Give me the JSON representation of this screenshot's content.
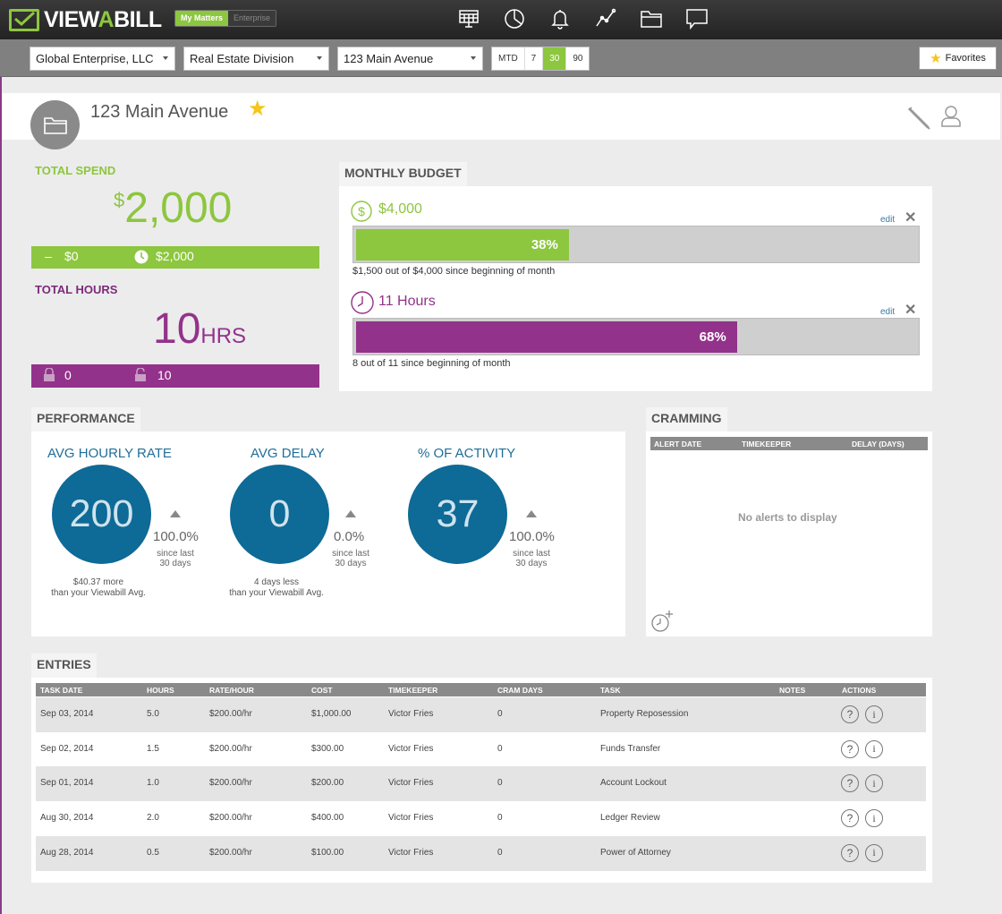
{
  "app": {
    "brand_part1": "VIEW",
    "brand_a": "A",
    "brand_part2": "BILL",
    "toggle_on": "My Matters",
    "toggle_off": "Enterprise"
  },
  "nav_icons": [
    "dashboard-icon",
    "pie-chart-icon",
    "bell-icon",
    "line-chart-icon",
    "folder-icon",
    "chat-icon"
  ],
  "filters": {
    "company": "Global Enterprise, LLC",
    "division": "Real Estate Division",
    "matter": "123 Main Avenue",
    "ranges": [
      "MTD",
      "7",
      "30",
      "90"
    ],
    "selected_range": "30",
    "favorites": "Favorites"
  },
  "matter": {
    "title": "123 Main Avenue"
  },
  "spend": {
    "label": "TOTAL SPEND",
    "currency": "$",
    "amount": "2,000",
    "left_value": "$0",
    "right_value": "$2,000"
  },
  "hours": {
    "label": "TOTAL HOURS",
    "amount": "10",
    "unit": "HRS",
    "locked": "0",
    "unlocked": "10"
  },
  "budget": {
    "tab": "MONTHLY BUDGET",
    "edit": "edit",
    "money": {
      "amount": "$4,000",
      "percent": 38,
      "percent_label": "38%",
      "note": "$1,500 out of $4,000 since beginning of month"
    },
    "time": {
      "amount": "11 Hours",
      "percent": 68,
      "percent_label": "68%",
      "note": "8 out of 11 since beginning of month"
    }
  },
  "performance": {
    "tab": "PERFORMANCE",
    "metrics": [
      {
        "title": "AVG HOURLY RATE",
        "value": "200",
        "change": "100.0%",
        "since1": "since last",
        "since2": "30 days",
        "below1": "$40.37 more",
        "below2": "than your Viewabill Avg."
      },
      {
        "title": "AVG DELAY",
        "value": "0",
        "change": "0.0%",
        "since1": "since last",
        "since2": "30 days",
        "below1": "4 days less",
        "below2": "than your Viewabill Avg."
      },
      {
        "title": "% OF ACTIVITY",
        "value": "37",
        "change": "100.0%",
        "since1": "since last",
        "since2": "30 days",
        "below1": "",
        "below2": ""
      }
    ]
  },
  "cramming": {
    "tab": "CRAMMING",
    "cols": [
      "ALERT DATE",
      "TIMEKEEPER",
      "DELAY (DAYS)"
    ],
    "empty": "No alerts to display"
  },
  "entries": {
    "tab": "ENTRIES",
    "cols": [
      "TASK DATE",
      "HOURS",
      "RATE/HOUR",
      "COST",
      "TIMEKEEPER",
      "CRAM DAYS",
      "TASK",
      "NOTES",
      "ACTIONS"
    ],
    "rows": [
      [
        "Sep 03, 2014",
        "5.0",
        "$200.00/hr",
        "$1,000.00",
        "Victor Fries",
        "0",
        "Property Reposession"
      ],
      [
        "Sep 02, 2014",
        "1.5",
        "$200.00/hr",
        "$300.00",
        "Victor Fries",
        "0",
        "Funds Transfer"
      ],
      [
        "Sep 01, 2014",
        "1.0",
        "$200.00/hr",
        "$200.00",
        "Victor Fries",
        "0",
        "Account Lockout"
      ],
      [
        "Aug 30, 2014",
        "2.0",
        "$200.00/hr",
        "$400.00",
        "Victor Fries",
        "0",
        "Ledger Review"
      ],
      [
        "Aug 28, 2014",
        "0.5",
        "$200.00/hr",
        "$100.00",
        "Victor Fries",
        "0",
        "Power of Attorney"
      ]
    ],
    "help_glyph": "?",
    "info_glyph": "i"
  },
  "colors": {
    "green": "#8dc63f",
    "purple": "#93328b",
    "blue": "#0e6a96"
  }
}
